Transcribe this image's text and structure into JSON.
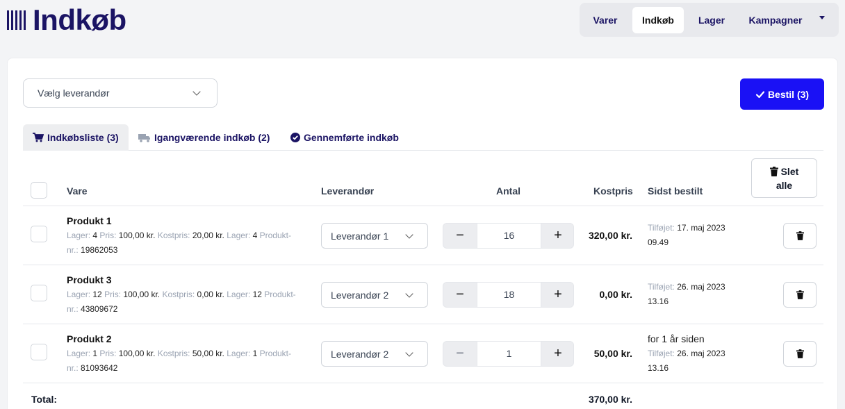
{
  "app": {
    "title": "Indkøb"
  },
  "nav": {
    "items": [
      "Varer",
      "Indkøb",
      "Lager",
      "Kampagner"
    ],
    "active": "Indkøb"
  },
  "toolbar": {
    "supplier_placeholder": "Vælg leverandør",
    "order_label": "Bestil (3)"
  },
  "tabs": [
    "Indkøbsliste (3)",
    "Igangværende indkøb (2)",
    "Gennemførte indkøb"
  ],
  "table": {
    "headers": {
      "product": "Vare",
      "supplier": "Leverandør",
      "quantity": "Antal",
      "cost": "Kostpris",
      "last_ordered": "Sidst bestilt"
    },
    "delete_all_line1": "Slet",
    "delete_all_line2": "alle"
  },
  "rows": [
    {
      "name": "Produkt 1",
      "meta": {
        "stock_label": "Lager:",
        "stock": "4",
        "price_label": "Pris:",
        "price": "100,00 kr.",
        "cost_label": "Kostpris:",
        "cost": "20,00 kr.",
        "stock2_label": "Lager:",
        "stock2": "4",
        "prodno_label_1": "Produkt-",
        "prodno_label_2": "nr.:",
        "prodno": "19862053"
      },
      "supplier": "Leverandør 1",
      "qty": "16",
      "total_cost": "320,00 kr.",
      "added_label": "Tilføjet:",
      "added_date": "17. maj 2023",
      "added_time": "09.49",
      "ago": ""
    },
    {
      "name": "Produkt 3",
      "meta": {
        "stock_label": "Lager:",
        "stock": "12",
        "price_label": "Pris:",
        "price": "100,00 kr.",
        "cost_label": "Kostpris:",
        "cost": "0,00 kr.",
        "stock2_label": "Lager:",
        "stock2": "12",
        "prodno_label_1": "Produkt-",
        "prodno_label_2": "nr.:",
        "prodno": "43809672"
      },
      "supplier": "Leverandør 2",
      "qty": "18",
      "total_cost": "0,00 kr.",
      "added_label": "Tilføjet:",
      "added_date": "26. maj 2023",
      "added_time": "13.16",
      "ago": ""
    },
    {
      "name": "Produkt 2",
      "meta": {
        "stock_label": "Lager:",
        "stock": "1",
        "price_label": "Pris:",
        "price": "100,00 kr.",
        "cost_label": "Kostpris:",
        "cost": "50,00 kr.",
        "stock2_label": "Lager:",
        "stock2": "1",
        "prodno_label_1": "Produkt-",
        "prodno_label_2": "nr.:",
        "prodno": "81093642"
      },
      "supplier": "Leverandør 2",
      "qty": "1",
      "total_cost": "50,00 kr.",
      "added_label": "Tilføjet:",
      "added_date": "26. maj 2023",
      "added_time": "13.16",
      "ago": "for 1 år siden"
    }
  ],
  "total": {
    "label": "Total:",
    "value": "370,00 kr."
  },
  "colors": {
    "brand": "#1b1464",
    "primary_button": "#1a11f5"
  }
}
